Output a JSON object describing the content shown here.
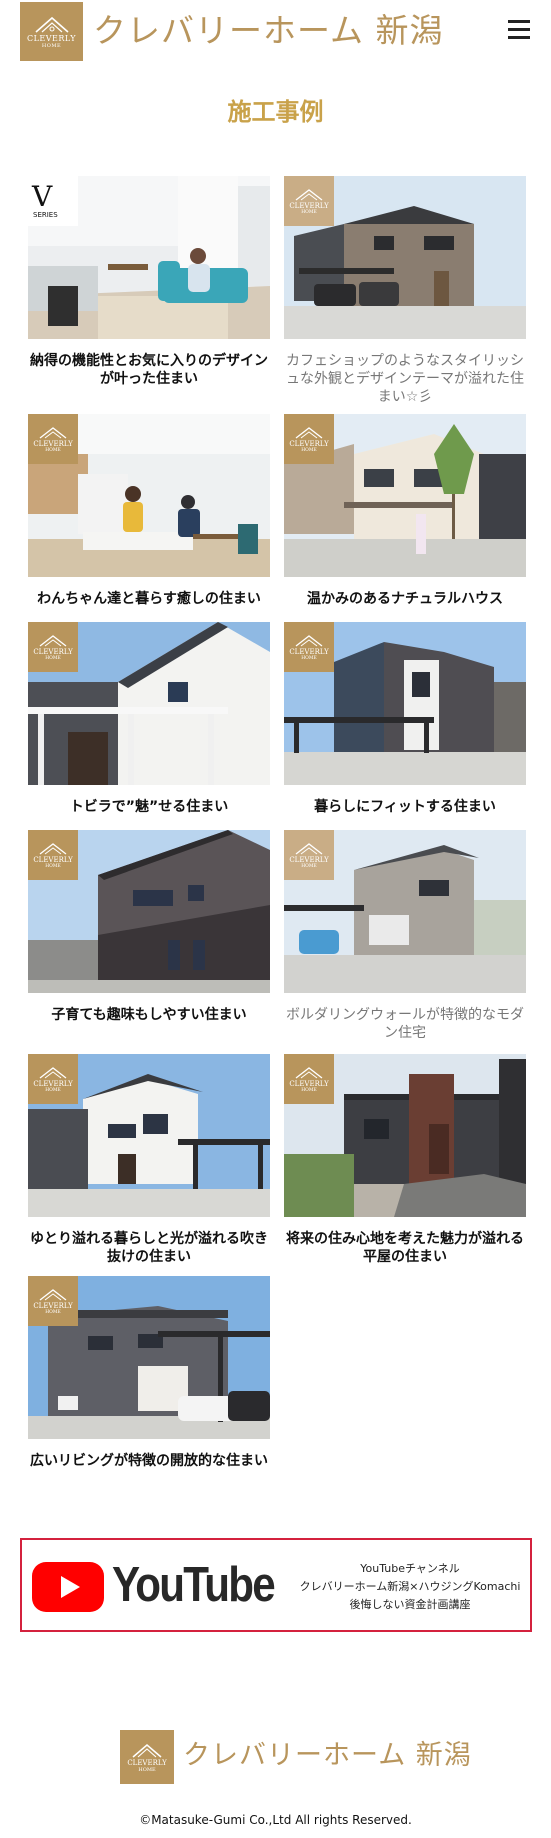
{
  "header": {
    "logo_text": "CLEVERLY",
    "logo_sub": "HOME",
    "brand": "クレバリーホーム 新潟",
    "menu_icon": "hamburger-menu-icon"
  },
  "page_title": "施工事例",
  "badges": {
    "cleverly": "CLEVERLY",
    "home": "HOME",
    "v_letter": "V",
    "series": "SERIES"
  },
  "cases": [
    {
      "title": "納得の機能性とお気に入りのデザインが叶った住まい"
    },
    {
      "title": "カフェショップのようなスタイリッシュな外観とデザインテーマが溢れた住まい☆彡"
    },
    {
      "title": "わんちゃん達と暮らす癒しの住まい"
    },
    {
      "title": "温かみのあるナチュラルハウス"
    },
    {
      "title": "トビラで”魅”せる住まい"
    },
    {
      "title": "暮らしにフィットする住まい"
    },
    {
      "title": "子育ても趣味もしやすい住まい"
    },
    {
      "title": "ボルダリングウォールが特徴的なモダン住宅"
    },
    {
      "title": "ゆとり溢れる暮らしと光が溢れる吹き抜けの住まい"
    },
    {
      "title": "将来の住み心地を考えた魅力が溢れる平屋の住まい"
    },
    {
      "title": "広いリビングが特徴の開放的な住まい"
    }
  ],
  "youtube": {
    "wordmark": "YouTube",
    "line1": "YouTubeチャンネル",
    "line2": "クレバリーホーム新潟×ハウジングKomachi",
    "line3": "後悔しない資金計画講座"
  },
  "footer": {
    "brand": "クレバリーホーム 新潟",
    "copyright": "©Matasuke-Gumi Co.,Ltd All rights Reserved."
  },
  "colors": {
    "brand_gold": "#b8955c",
    "title_gold": "#c9a24a",
    "youtube_red": "#ff0000",
    "banner_border": "#d4213d"
  }
}
